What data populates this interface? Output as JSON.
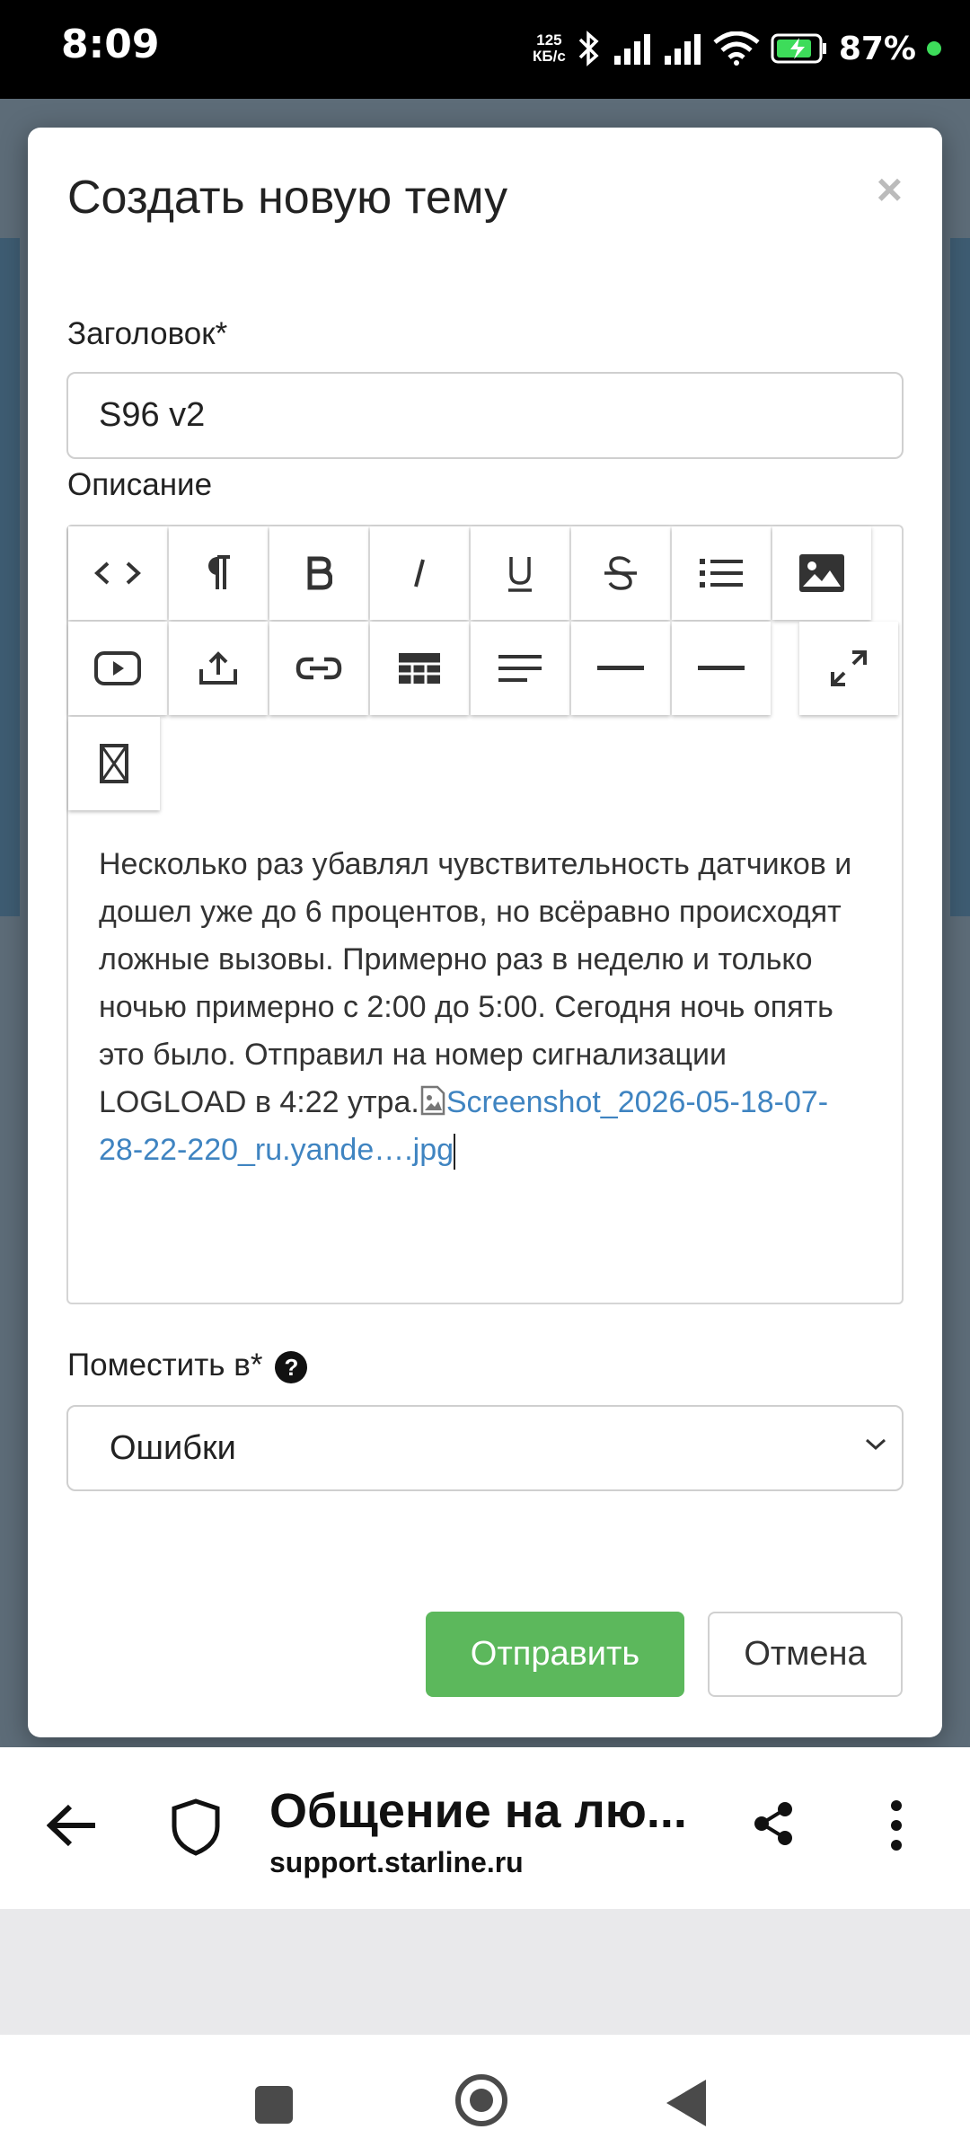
{
  "status_bar": {
    "time": "8:09",
    "net_speed_value": "125",
    "net_speed_unit": "КБ/с",
    "battery": "87%"
  },
  "modal": {
    "title": "Создать новую тему",
    "close_glyph": "×",
    "title_field": {
      "label": "Заголовок",
      "required_mark": "*",
      "value": "S96 v2"
    },
    "description": {
      "label": "Описание",
      "toolbar": [
        "code-view",
        "paragraph",
        "bold",
        "italic",
        "underline",
        "strikethrough",
        "unordered-list",
        "picture",
        "video",
        "upload",
        "link",
        "table",
        "align",
        "hr",
        "hr",
        "fullscreen",
        "clear"
      ],
      "text": "Несколько раз убавлял чувствительность датчиков и дошел уже до 6 процентов, но всёравно происходят ложные вызовы. Примерно раз в неделю и только ночью примерно с 2:00 до 5:00. Сегодня ночь опять это было. Отправил на номер сигнализации LOGLOAD в 4:22 утра.",
      "attachment_name": "Screenshot_2026-05-18-07-28-22-220_ru.yande….jpg"
    },
    "place_in": {
      "label": "Поместить в",
      "required_mark": "*",
      "help_glyph": "?",
      "selected": "Ошибки"
    },
    "submit_label": "Отправить",
    "cancel_label": "Отмена"
  },
  "browser": {
    "page_title": "Общение на лю...",
    "domain": "support.starline.ru"
  },
  "colors": {
    "accent_green": "#5cb85c",
    "link_blue": "#3f84c1"
  }
}
